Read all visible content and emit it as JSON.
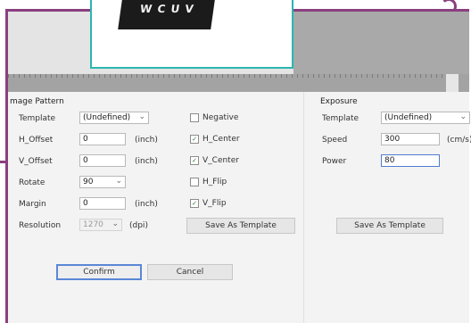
{
  "image_pattern": {
    "title": "mage Pattern",
    "rows": {
      "template": {
        "label": "Template",
        "value": "(Undefined)"
      },
      "h_offset": {
        "label": "H_Offset",
        "value": "0",
        "unit": "(inch)"
      },
      "v_offset": {
        "label": "V_Offset",
        "value": "0",
        "unit": "(inch)"
      },
      "rotate": {
        "label": "Rotate",
        "value": "90"
      },
      "margin": {
        "label": "Margin",
        "value": "0",
        "unit": "(inch)"
      },
      "resolution": {
        "label": "Resolution",
        "value": "1270",
        "unit": "(dpi)"
      }
    },
    "checks": [
      {
        "label": "Negative",
        "checked": false
      },
      {
        "label": "H_Center",
        "checked": true
      },
      {
        "label": "V_Center",
        "checked": true
      },
      {
        "label": "H_Flip",
        "checked": false
      },
      {
        "label": "V_Flip",
        "checked": true
      }
    ],
    "save_template": "Save As Template"
  },
  "exposure": {
    "title": "Exposure",
    "template": {
      "label": "Template",
      "value": "(Undefined)"
    },
    "speed": {
      "label": "Speed",
      "value": "300",
      "unit": "(cm/s)"
    },
    "power": {
      "label": "Power",
      "value": "80"
    },
    "save_template": "Save As Template"
  },
  "actions": {
    "confirm": "Confirm",
    "cancel": "Cancel"
  },
  "preview": {
    "art_text": "W C U V"
  }
}
